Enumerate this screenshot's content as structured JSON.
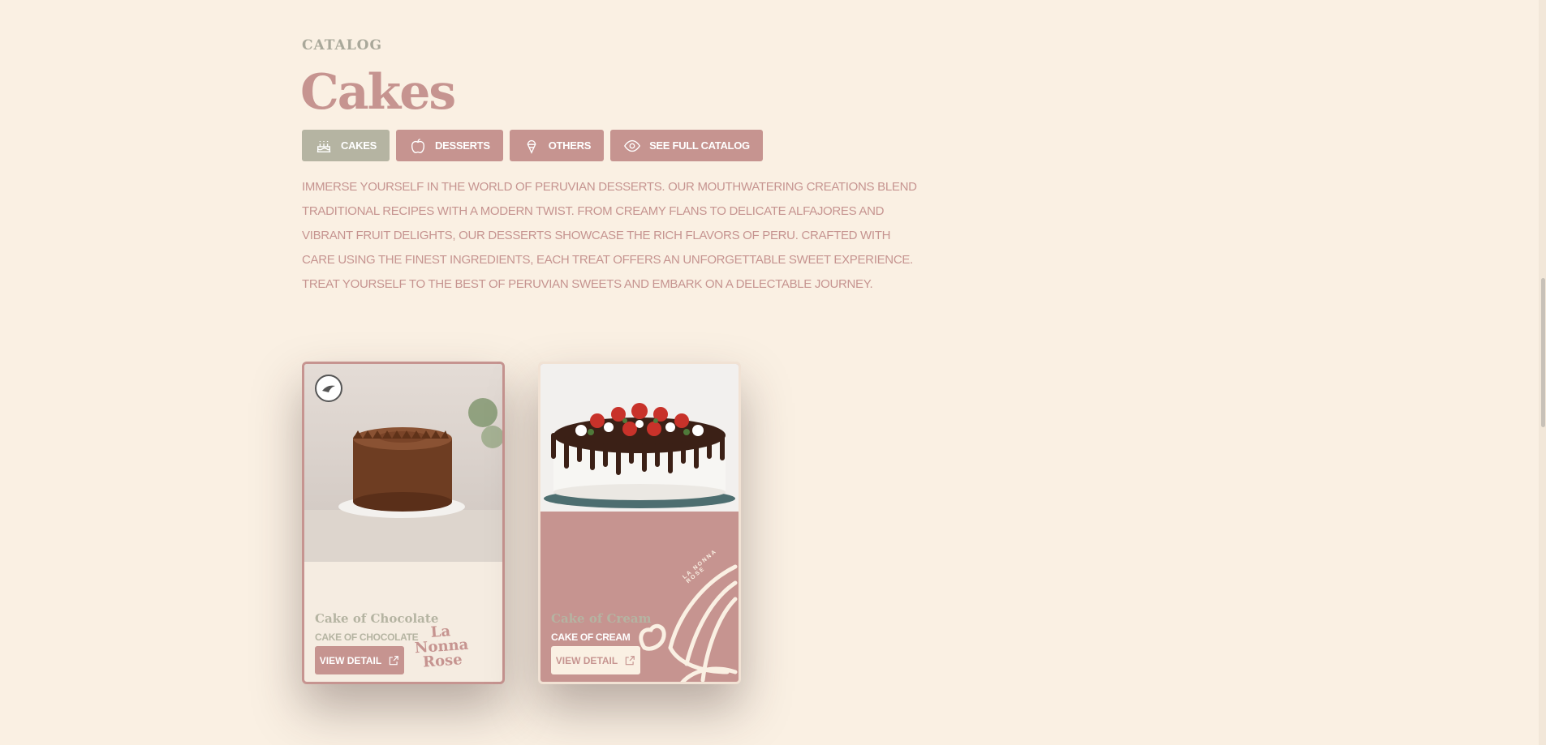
{
  "section": {
    "eyebrow": "CATALOG",
    "title": "Cakes",
    "description": "IMMERSE YOURSELF IN THE WORLD OF PERUVIAN DESSERTS. OUR MOUTHWATERING CREATIONS BLEND TRADITIONAL RECIPES WITH A MODERN TWIST. FROM CREAMY FLANS TO DELICATE ALFAJORES AND VIBRANT FRUIT DELIGHTS, OUR DESSERTS SHOWCASE THE RICH FLAVORS OF PERU. CRAFTED WITH CARE USING THE FINEST INGREDIENTS, EACH TREAT OFFERS AN UNFORGETTABLE SWEET EXPERIENCE. TREAT YOURSELF TO THE BEST OF PERUVIAN SWEETS AND EMBARK ON A DELECTABLE JOURNEY."
  },
  "tabs": [
    {
      "label": "CAKES",
      "icon": "cake-icon",
      "active": true
    },
    {
      "label": "DESSERTS",
      "icon": "apple-icon",
      "active": false
    },
    {
      "label": "OTHERS",
      "icon": "ice-cream-icon",
      "active": false
    },
    {
      "label": "SEE FULL CATALOG",
      "icon": "eye-icon",
      "active": false
    }
  ],
  "products": [
    {
      "name": "Cake of Chocolate",
      "subtitle": "CAKE OF CHOCOLATE",
      "button_label": "VIEW DETAIL",
      "logo_line1": "La",
      "logo_line2": "Nonna",
      "logo_line3": "Rose"
    },
    {
      "name": "Cake of Cream",
      "subtitle": "CAKE OF CREAM",
      "button_label": "VIEW DETAIL",
      "brand_arc_text": "LA NONNA ROSE"
    }
  ],
  "colors": {
    "background": "#faf0e3",
    "accent": "#c69490",
    "active_tab": "#b5b4a2"
  }
}
